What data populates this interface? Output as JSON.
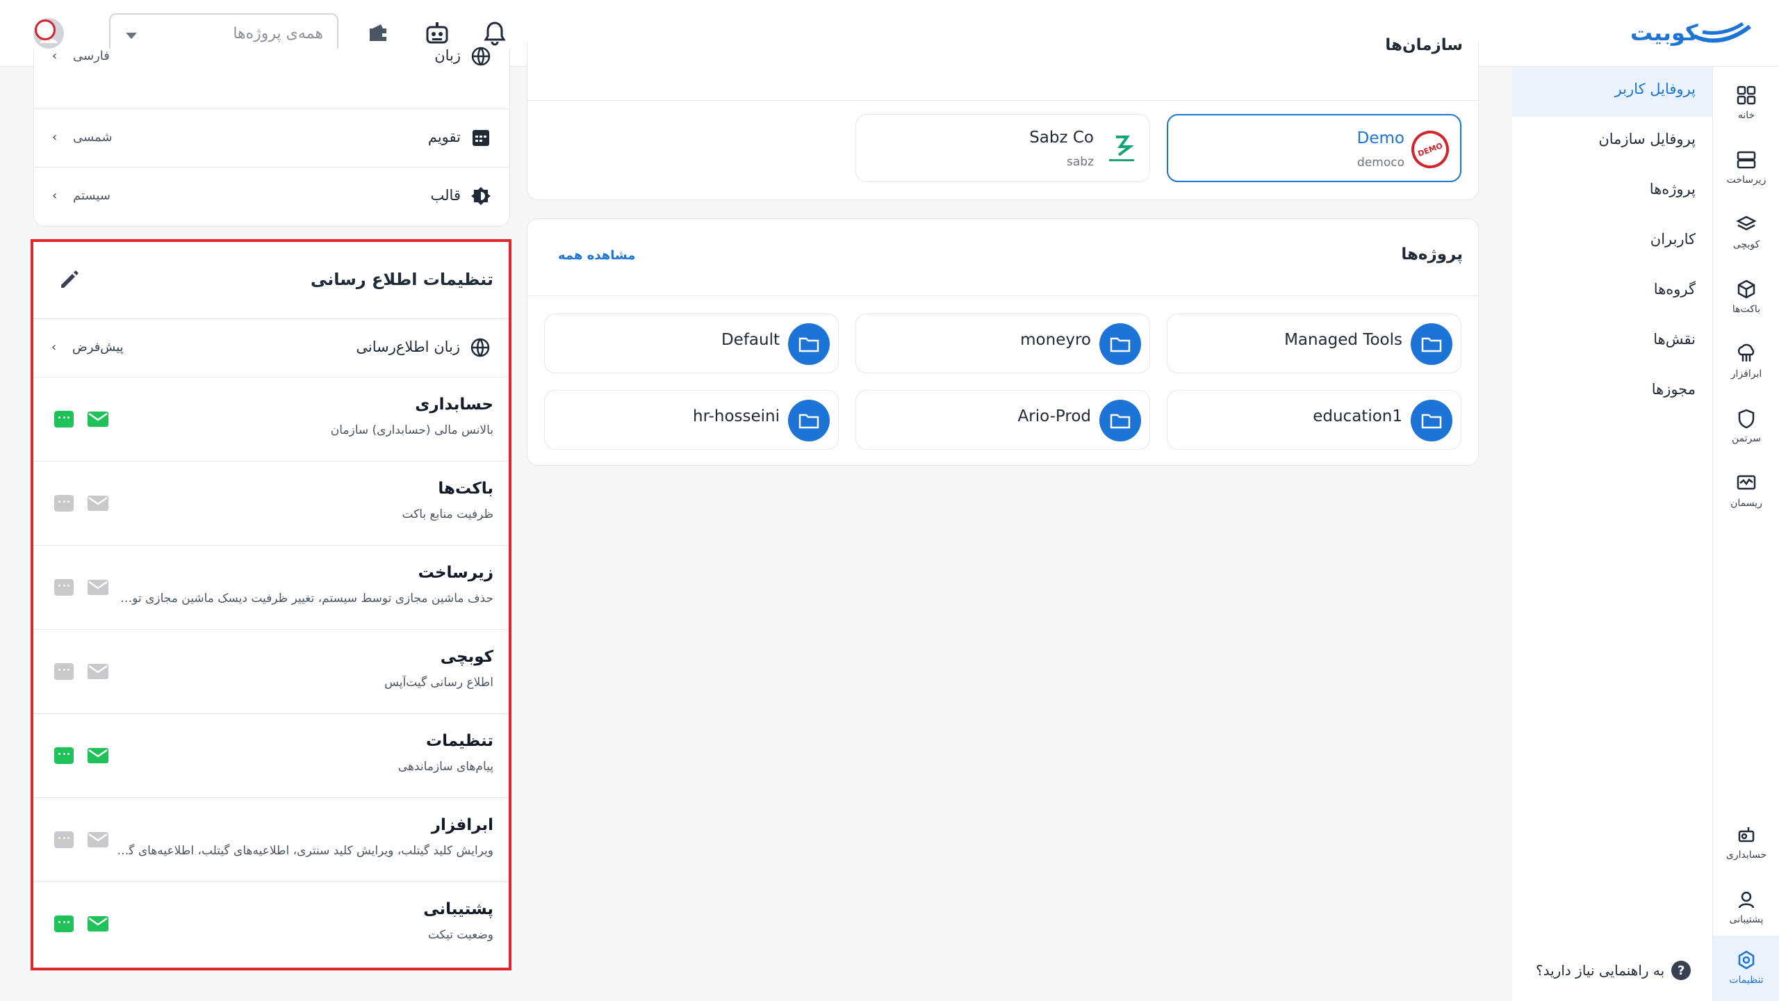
{
  "header": {
    "brand": "کوبیت",
    "project_placeholder": "همه‌ی پروژه‌ها"
  },
  "rail": {
    "items": [
      {
        "label": "خانه",
        "icon": "grid-icon"
      },
      {
        "label": "زیرساخت",
        "icon": "server-icon"
      },
      {
        "label": "کوبچی",
        "icon": "layers-icon"
      },
      {
        "label": "باکت‌ها",
        "icon": "cube-icon"
      },
      {
        "label": "ابرافزار",
        "icon": "cloud-app-icon"
      },
      {
        "label": "سرتمن",
        "icon": "shield-icon"
      },
      {
        "label": "ریسمان",
        "icon": "monitor-icon"
      }
    ],
    "bottom": [
      {
        "label": "حسابداری",
        "icon": "accounting-icon"
      },
      {
        "label": "پشتیبانی",
        "icon": "support-icon"
      },
      {
        "label": "تنظیمات",
        "icon": "settings-icon"
      }
    ]
  },
  "submenu": {
    "items": [
      "پروفایل کاربر",
      "پروفایل سازمان",
      "پروژه‌ها",
      "کاربران",
      "گروه‌ها",
      "نقش‌ها",
      "مجوزها"
    ],
    "help": "به راهنمایی نیاز دارید؟"
  },
  "orgs": {
    "title": "سازمان‌ها",
    "cards": [
      {
        "name": "Demo",
        "slug": "democo"
      },
      {
        "name": "Sabz Co",
        "slug": "sabz"
      }
    ]
  },
  "projects": {
    "title": "پروژه‌ها",
    "view_all": "مشاهده همه",
    "items": [
      "Managed Tools",
      "moneyro",
      "Default",
      "education1",
      "Ario-Prod",
      "hr-hosseini"
    ]
  },
  "prefs": [
    {
      "label": "زبان",
      "value": "فارسی",
      "icon": "globe-icon"
    },
    {
      "label": "تقویم",
      "value": "شمسی",
      "icon": "calendar-icon"
    },
    {
      "label": "قالب",
      "value": "سیستم",
      "icon": "theme-icon"
    }
  ],
  "notifications": {
    "title": "تنظیمات اطلاع رسانی",
    "language_label": "زبان اطلاع‌رسانی",
    "language_value": "پیش‌فرض",
    "rows": [
      {
        "title": "حسابداری",
        "desc": "بالانس مالی (حسابداری) سازمان",
        "sms": true,
        "email": true
      },
      {
        "title": "باکت‌ها",
        "desc": "ظرفیت منابع باکت",
        "sms": false,
        "email": false
      },
      {
        "title": "زیرساخت",
        "desc": "حذف ماشین مجازی توسط سیستم، تغییر ظرفیت دیسک ماشین مجازی توسط سیستم",
        "sms": false,
        "email": false
      },
      {
        "title": "کوبچی",
        "desc": "اطلاع رسانی گیت‌آپس",
        "sms": false,
        "email": false
      },
      {
        "title": "تنظیمات",
        "desc": "پیام‌های سازماندهی",
        "sms": true,
        "email": true
      },
      {
        "title": "ابرافزار",
        "desc": "ویرایش کلید گیتلب، ویرایش کلید سنتری، اطلاعیه‌های گیتلب، اطلاعیه‌های گیتلب",
        "sms": false,
        "email": false
      },
      {
        "title": "پشتیبانی",
        "desc": "وضعیت تیکت",
        "sms": true,
        "email": true
      }
    ]
  },
  "colors": {
    "accent": "#1b74d6",
    "enabled": "#1fc159",
    "disabled": "#c7c9cd",
    "highlight": "#e0262a"
  }
}
